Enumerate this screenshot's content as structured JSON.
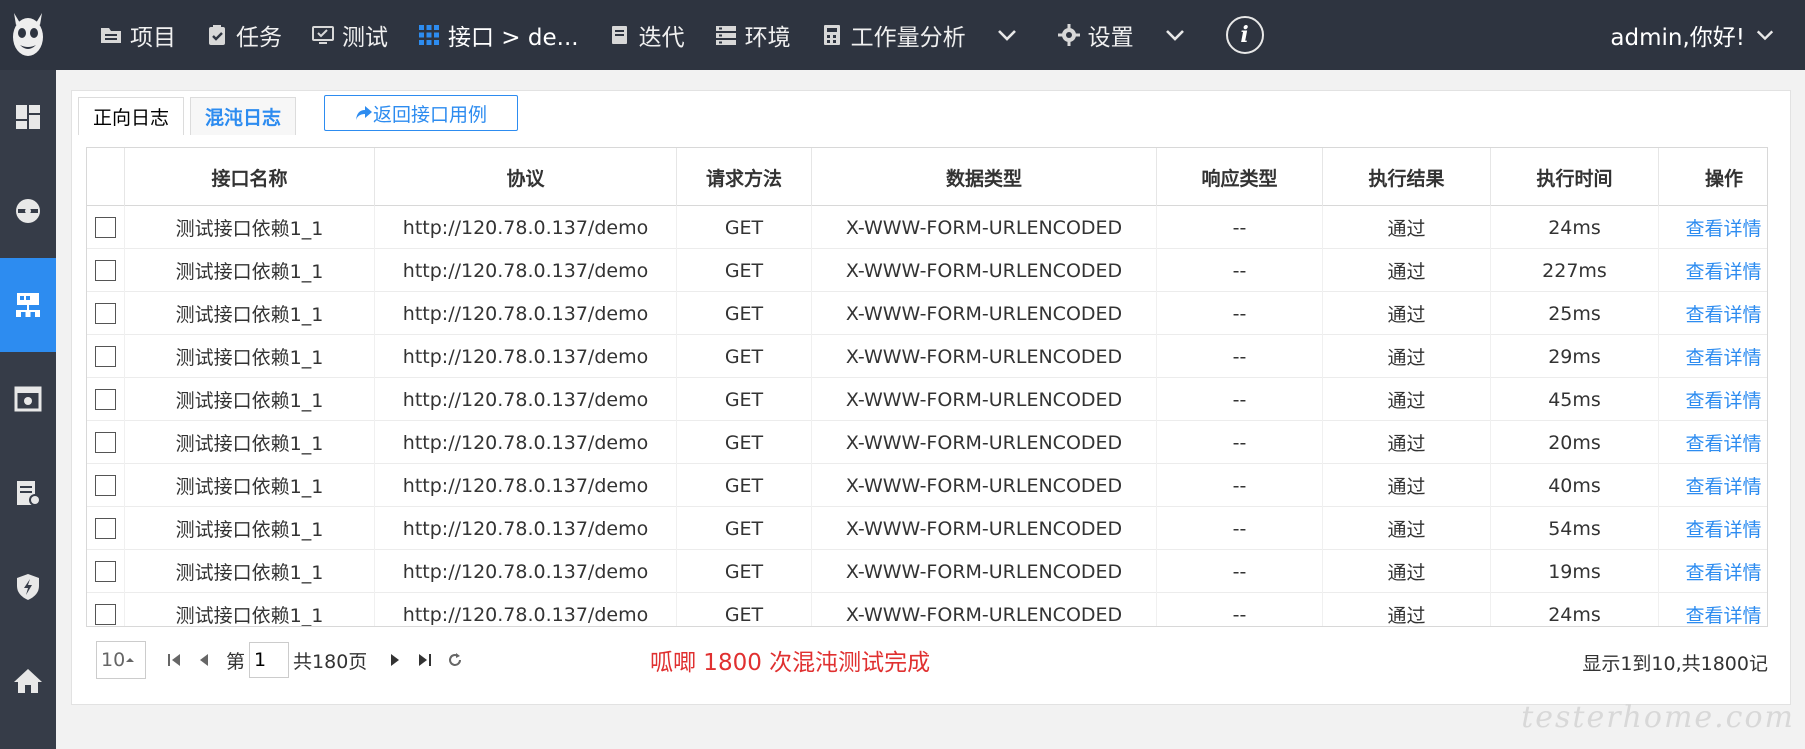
{
  "nav": {
    "items": [
      {
        "label": "项目",
        "icon": "folder-icon"
      },
      {
        "label": "任务",
        "icon": "clipboard-check-icon"
      },
      {
        "label": "测试",
        "icon": "monitor-check-icon"
      },
      {
        "label": "接口 > de...",
        "icon": "grid-icon"
      },
      {
        "label": "迭代",
        "icon": "book-icon"
      },
      {
        "label": "环境",
        "icon": "server-icon"
      },
      {
        "label": "工作量分析",
        "icon": "calculator-icon"
      }
    ],
    "settings_label": "设置",
    "info_glyph": "i",
    "user_label": "admin,你好!"
  },
  "tabs": {
    "forward_log": "正向日志",
    "chaos_log": "混沌日志",
    "return_label": "返回接口用例"
  },
  "table": {
    "headers": [
      "接口名称",
      "协议",
      "请求方法",
      "数据类型",
      "响应类型",
      "执行结果",
      "执行时间",
      "操作"
    ],
    "rows": [
      {
        "name": "测试接口依赖1_1",
        "protocol": "http://120.78.0.137/demo",
        "method": "GET",
        "data_type": "X-WWW-FORM-URLENCODED",
        "resp_type": "--",
        "result": "通过",
        "time": "24ms",
        "action": "查看详情"
      },
      {
        "name": "测试接口依赖1_1",
        "protocol": "http://120.78.0.137/demo",
        "method": "GET",
        "data_type": "X-WWW-FORM-URLENCODED",
        "resp_type": "--",
        "result": "通过",
        "time": "227ms",
        "action": "查看详情"
      },
      {
        "name": "测试接口依赖1_1",
        "protocol": "http://120.78.0.137/demo",
        "method": "GET",
        "data_type": "X-WWW-FORM-URLENCODED",
        "resp_type": "--",
        "result": "通过",
        "time": "25ms",
        "action": "查看详情"
      },
      {
        "name": "测试接口依赖1_1",
        "protocol": "http://120.78.0.137/demo",
        "method": "GET",
        "data_type": "X-WWW-FORM-URLENCODED",
        "resp_type": "--",
        "result": "通过",
        "time": "29ms",
        "action": "查看详情"
      },
      {
        "name": "测试接口依赖1_1",
        "protocol": "http://120.78.0.137/demo",
        "method": "GET",
        "data_type": "X-WWW-FORM-URLENCODED",
        "resp_type": "--",
        "result": "通过",
        "time": "45ms",
        "action": "查看详情"
      },
      {
        "name": "测试接口依赖1_1",
        "protocol": "http://120.78.0.137/demo",
        "method": "GET",
        "data_type": "X-WWW-FORM-URLENCODED",
        "resp_type": "--",
        "result": "通过",
        "time": "20ms",
        "action": "查看详情"
      },
      {
        "name": "测试接口依赖1_1",
        "protocol": "http://120.78.0.137/demo",
        "method": "GET",
        "data_type": "X-WWW-FORM-URLENCODED",
        "resp_type": "--",
        "result": "通过",
        "time": "40ms",
        "action": "查看详情"
      },
      {
        "name": "测试接口依赖1_1",
        "protocol": "http://120.78.0.137/demo",
        "method": "GET",
        "data_type": "X-WWW-FORM-URLENCODED",
        "resp_type": "--",
        "result": "通过",
        "time": "54ms",
        "action": "查看详情"
      },
      {
        "name": "测试接口依赖1_1",
        "protocol": "http://120.78.0.137/demo",
        "method": "GET",
        "data_type": "X-WWW-FORM-URLENCODED",
        "resp_type": "--",
        "result": "通过",
        "time": "19ms",
        "action": "查看详情"
      },
      {
        "name": "测试接口依赖1_1",
        "protocol": "http://120.78.0.137/demo",
        "method": "GET",
        "data_type": "X-WWW-FORM-URLENCODED",
        "resp_type": "--",
        "result": "通过",
        "time": "24ms",
        "action": "查看详情"
      }
    ]
  },
  "pager": {
    "page_size": "10",
    "page_prefix": "第",
    "page_value": "1",
    "page_total": "共180页",
    "message": "呱唧  1800 次混沌测试完成",
    "summary": "显示1到10,共1800记"
  },
  "watermark": "testerhome.com",
  "colors": {
    "accent": "#2d8cf0",
    "topbar": "#2e3440",
    "sidebar": "#363c48",
    "message": "#e03030"
  }
}
